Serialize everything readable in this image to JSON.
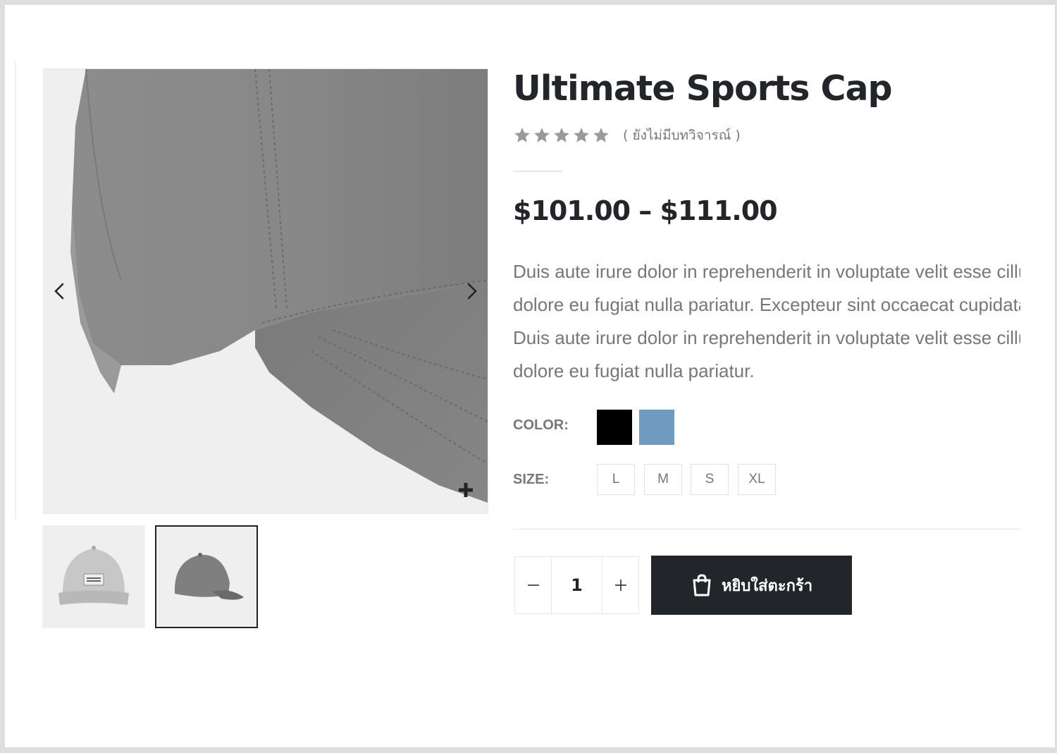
{
  "product": {
    "title": "Ultimate Sports Cap",
    "rating_stars": 5,
    "rating_value": 0,
    "review_link": "( ยังไม่มีบทวิจารณ์ )",
    "price_range": "$101.00 – $111.00",
    "description_lines": [
      "Duis aute irure dolor in reprehenderit in voluptate velit esse cillum",
      "dolore eu fugiat nulla pariatur. Excepteur sint occaecat cupidatat non",
      "Duis aute irure dolor in reprehenderit in voluptate velit esse cillum",
      "dolore eu fugiat nulla pariatur."
    ]
  },
  "options": {
    "color_label": "COLOR:",
    "colors": [
      {
        "name": "black",
        "hex": "#000000"
      },
      {
        "name": "blue",
        "hex": "#6f9bc1"
      }
    ],
    "size_label": "SIZE:",
    "sizes": [
      "L",
      "M",
      "S",
      "XL"
    ]
  },
  "cart": {
    "quantity": "1",
    "add_to_cart_label": "หยิบใส่ตะกร้า"
  },
  "gallery": {
    "selected_thumbnail": 2,
    "thumbnail_count": 2
  },
  "icons": {
    "prev": "chevron-left-icon",
    "next": "chevron-right-icon",
    "zoom": "plus-icon",
    "cart": "shopping-bag-icon",
    "star": "star-icon"
  },
  "colors": {
    "text_dark": "#222529",
    "text_muted": "#777777",
    "star_empty": "#9a9a9a",
    "button_bg": "#222529"
  }
}
